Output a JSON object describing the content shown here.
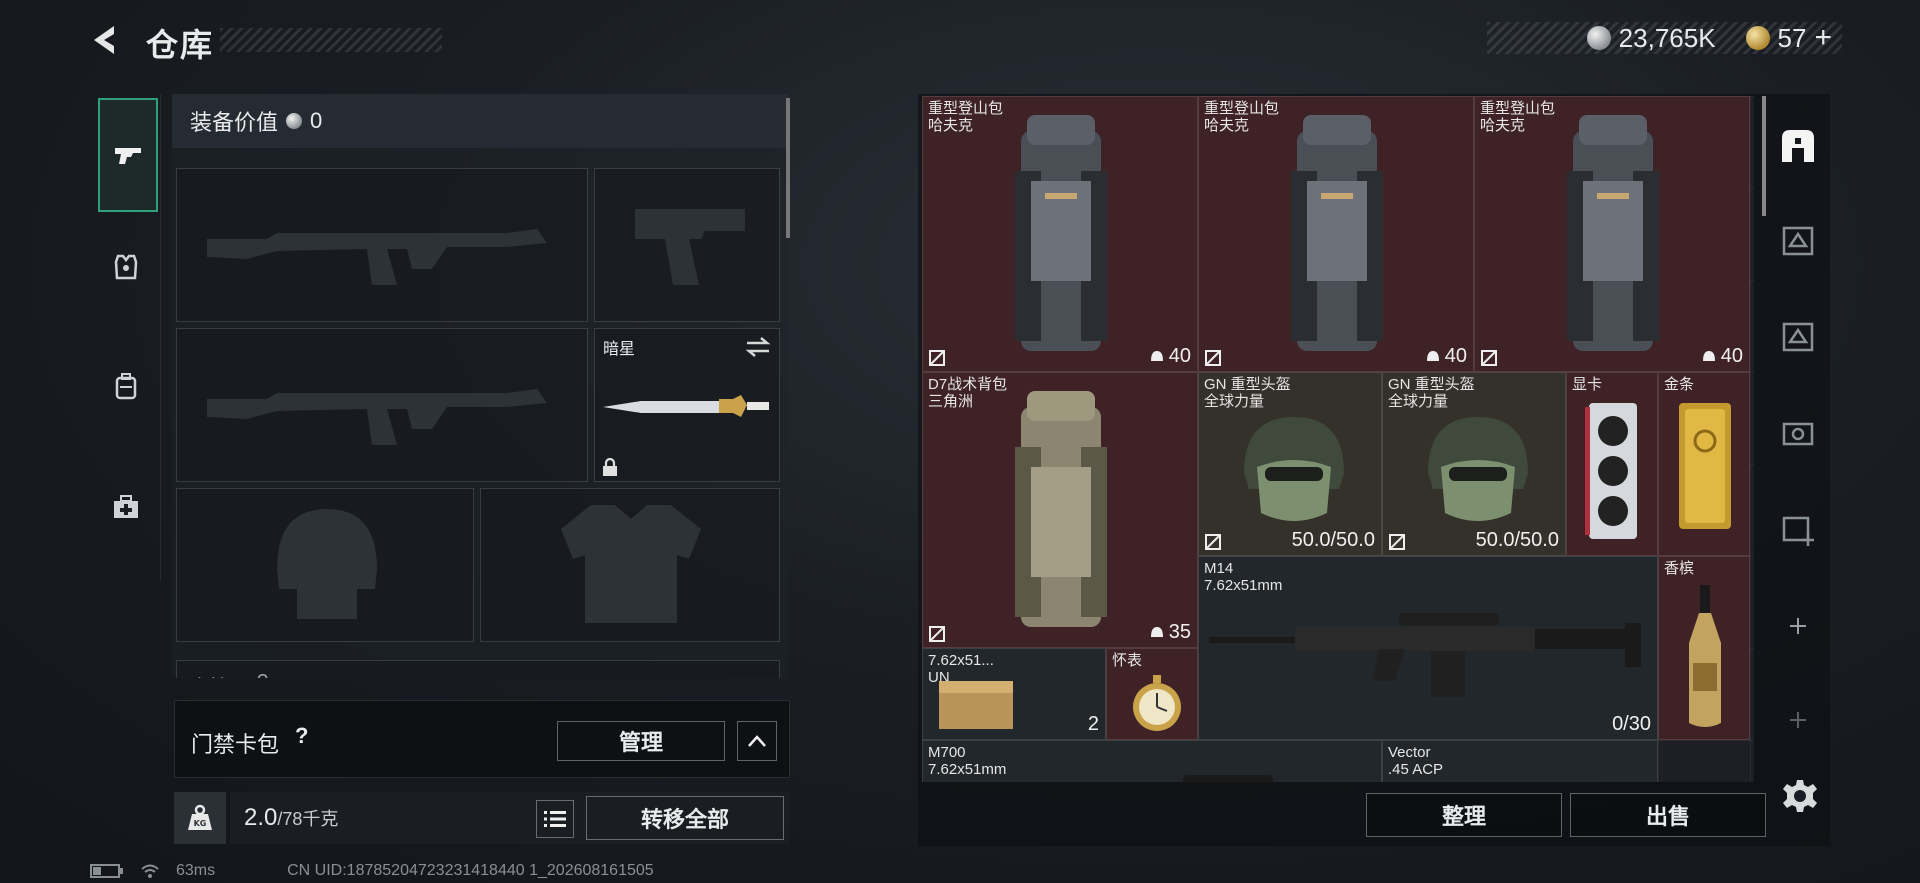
{
  "header": {
    "title": "仓库",
    "silver": "23,765K",
    "gold": "57",
    "gold_plus": "+"
  },
  "tabs": [
    {
      "name": "weapons-tab",
      "icon": "pistol-icon",
      "active": true
    },
    {
      "name": "armor-tab",
      "icon": "armor-vest-icon",
      "active": false
    },
    {
      "name": "backpack-tab",
      "icon": "backpack-icon",
      "active": false
    },
    {
      "name": "medkit-tab",
      "icon": "medkit-icon",
      "active": false
    }
  ],
  "equipment": {
    "value_label": "装备价值",
    "value": "0",
    "melee_name": "暗星",
    "next_section_label": "胸挂",
    "next_section_value": "?"
  },
  "card_pack": {
    "label": "门禁卡包",
    "help": "?",
    "manage": "管理"
  },
  "weight": {
    "current": "2.0",
    "capacity": "/78千克",
    "transfer_all": "转移全部"
  },
  "stash": {
    "items": [
      {
        "name": "重型登山包\n哈夫克",
        "value": "40"
      },
      {
        "name": "重型登山包\n哈夫克",
        "value": "40"
      },
      {
        "name": "重型登山包\n哈夫克",
        "value": "40"
      },
      {
        "name": "D7战术背包\n三角洲",
        "value": "35"
      },
      {
        "name": "GN 重型头盔\n全球力量",
        "value": "50.0/50.0"
      },
      {
        "name": "GN 重型头盔\n全球力量",
        "value": "50.0/50.0"
      },
      {
        "name": "显卡",
        "value": ""
      },
      {
        "name": "金条",
        "value": ""
      },
      {
        "name": "M14\n7.62x51mm",
        "value": "0/30"
      },
      {
        "name": "香槟",
        "value": ""
      },
      {
        "name": "7.62x51...\nUN",
        "value": "2"
      },
      {
        "name": "怀表",
        "value": ""
      },
      {
        "name": "M700\n7.62x51mm",
        "value": ""
      },
      {
        "name": "Vector\n.45 ACP",
        "value": ""
      }
    ],
    "sort": "整理",
    "sell": "出售"
  },
  "sidebar_icons": [
    "home-icon",
    "tier-3-case-icon",
    "tier-3-case-icon",
    "tier-4-case-icon",
    "tier-4-add-case-icon",
    "plus-icon",
    "plus-icon"
  ],
  "status": {
    "ping": "63ms",
    "uid": "CN UID:18785204723231418440 1_202608161505"
  },
  "colors": {
    "accent": "#2fa07a",
    "item_red": "#3e2226",
    "item_olive": "#34302a"
  }
}
